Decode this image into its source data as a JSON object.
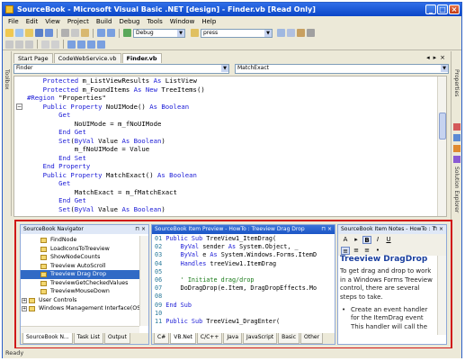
{
  "window": {
    "title": "SourceBook - Microsoft Visual Basic .NET [design] - Finder.vb [Read Only]"
  },
  "menu": [
    "File",
    "Edit",
    "View",
    "Project",
    "Build",
    "Debug",
    "Tools",
    "Window",
    "Help"
  ],
  "toolbar": {
    "config": "Debug",
    "find": "press"
  },
  "left_strip": {
    "toolbox": "Toolbox"
  },
  "right_strip": {
    "properties": "Properties",
    "solution": "Solution Explorer"
  },
  "doc_tabs": [
    "Start Page",
    "CodeWebService.vb",
    "Finder.vb"
  ],
  "editor": {
    "class_combo": "Finder",
    "member_combo": "MatchExact",
    "lines": [
      {
        "indent": "    ",
        "parts": [
          [
            "kw",
            "Protected "
          ],
          [
            "",
            "m_ListViewResults "
          ],
          [
            "kw",
            "As "
          ],
          [
            "",
            "ListView"
          ]
        ]
      },
      {
        "indent": "    ",
        "parts": [
          [
            "kw",
            "Protected "
          ],
          [
            "",
            "m_FoundItems "
          ],
          [
            "kw",
            "As New "
          ],
          [
            "",
            "TreeItems()"
          ]
        ]
      },
      {
        "indent": "",
        "parts": [
          [
            "",
            ""
          ]
        ]
      },
      {
        "indent": "",
        "parts": [
          [
            "kw",
            "#Region "
          ],
          [
            "",
            "\"Properties\""
          ]
        ]
      },
      {
        "indent": "",
        "parts": [
          [
            "",
            ""
          ]
        ]
      },
      {
        "indent": "    ",
        "parts": [
          [
            "kw",
            "Public Property "
          ],
          [
            "",
            "NoUIMode() "
          ],
          [
            "kw",
            "As Boolean"
          ]
        ]
      },
      {
        "indent": "        ",
        "parts": [
          [
            "kw",
            "Get"
          ]
        ]
      },
      {
        "indent": "            ",
        "parts": [
          [
            "",
            "NoUIMode = m_fNoUIMode"
          ]
        ]
      },
      {
        "indent": "        ",
        "parts": [
          [
            "kw",
            "End Get"
          ]
        ]
      },
      {
        "indent": "        ",
        "parts": [
          [
            "kw",
            "Set"
          ],
          [
            "",
            "("
          ],
          [
            "kw",
            "ByVal "
          ],
          [
            "",
            "Value "
          ],
          [
            "kw",
            "As Boolean"
          ],
          [
            "",
            ")"
          ]
        ]
      },
      {
        "indent": "            ",
        "parts": [
          [
            "",
            "m_fNoUIMode = Value"
          ]
        ]
      },
      {
        "indent": "        ",
        "parts": [
          [
            "kw",
            "End Set"
          ]
        ]
      },
      {
        "indent": "    ",
        "parts": [
          [
            "kw",
            "End Property"
          ]
        ]
      },
      {
        "indent": "",
        "parts": [
          [
            "",
            ""
          ]
        ]
      },
      {
        "indent": "    ",
        "parts": [
          [
            "kw",
            "Public Property "
          ],
          [
            "",
            "MatchExact() "
          ],
          [
            "kw",
            "As Boolean"
          ]
        ]
      },
      {
        "indent": "        ",
        "parts": [
          [
            "kw",
            "Get"
          ]
        ]
      },
      {
        "indent": "            ",
        "parts": [
          [
            "",
            "MatchExact = m_fMatchExact"
          ]
        ]
      },
      {
        "indent": "        ",
        "parts": [
          [
            "kw",
            "End Get"
          ]
        ]
      },
      {
        "indent": "        ",
        "parts": [
          [
            "kw",
            "Set"
          ],
          [
            "",
            "("
          ],
          [
            "kw",
            "ByVal "
          ],
          [
            "",
            "Value "
          ],
          [
            "kw",
            "As Boolean"
          ],
          [
            "",
            ")"
          ]
        ]
      }
    ]
  },
  "navigator": {
    "title": "SourceBook Navigator",
    "items": [
      {
        "label": "FindNode",
        "type": "item",
        "selected": false
      },
      {
        "label": "LoadIconsToTreeview",
        "type": "item",
        "selected": false
      },
      {
        "label": "ShowNodeCounts",
        "type": "item",
        "selected": false
      },
      {
        "label": "Treeview AutoScroll",
        "type": "item",
        "selected": false
      },
      {
        "label": "Treeview Drag Drop",
        "type": "item",
        "selected": true
      },
      {
        "label": "TreeviewGetCheckedValues",
        "type": "item",
        "selected": false
      },
      {
        "label": "TreeviewMouseDown",
        "type": "item",
        "selected": false
      },
      {
        "label": "User Controls",
        "type": "folder",
        "selected": false
      },
      {
        "label": "Windows Management Interface(OS",
        "type": "folder",
        "selected": false
      }
    ],
    "tabs": [
      "SourceBook N...",
      "Task List",
      "Output"
    ]
  },
  "preview": {
    "title": "SourceBook Item Preview - HowTo : Treeview Drag Drop",
    "lines": [
      {
        "n": "01",
        "parts": [
          [
            "kw",
            "Public Sub "
          ],
          [
            "",
            "TreeView1_ItemDrag("
          ]
        ]
      },
      {
        "n": "02",
        "parts": [
          [
            "",
            "    "
          ],
          [
            "kw",
            "ByVal "
          ],
          [
            "",
            "sender "
          ],
          [
            "kw",
            "As "
          ],
          [
            "",
            "System.Object, _"
          ]
        ]
      },
      {
        "n": "03",
        "parts": [
          [
            "",
            "    "
          ],
          [
            "kw",
            "ByVal "
          ],
          [
            "",
            "e "
          ],
          [
            "kw",
            "As "
          ],
          [
            "",
            "System.Windows.Forms.ItemD"
          ]
        ]
      },
      {
        "n": "04",
        "parts": [
          [
            "",
            "    "
          ],
          [
            "kw",
            "Handles "
          ],
          [
            "",
            "treeView1.ItemDrag"
          ]
        ]
      },
      {
        "n": "05",
        "parts": [
          [
            "",
            ""
          ]
        ]
      },
      {
        "n": "06",
        "parts": [
          [
            "",
            "    "
          ],
          [
            "cm",
            "' Initiate drag/drop"
          ]
        ]
      },
      {
        "n": "07",
        "parts": [
          [
            "",
            "    DoDragDrop(e.Item, DragDropEffects.Mo"
          ]
        ]
      },
      {
        "n": "08",
        "parts": [
          [
            "",
            ""
          ]
        ]
      },
      {
        "n": "09",
        "parts": [
          [
            "kw",
            "End Sub"
          ]
        ]
      },
      {
        "n": "10",
        "parts": [
          [
            "",
            ""
          ]
        ]
      },
      {
        "n": "11",
        "parts": [
          [
            "kw",
            "Public Sub "
          ],
          [
            "",
            "TreeView1_DragEnter("
          ]
        ]
      }
    ],
    "tabs": [
      "C#",
      "VB.Net",
      "C/C++",
      "Java",
      "JavaScript",
      "Basic",
      "Other"
    ]
  },
  "notes": {
    "title": "SourceBook Item Notes - HowTo : T",
    "heading": "Treeview DragDrop",
    "body": "To get drag and drop to work in a Windows Forms Treeview control, there are several steps to take.",
    "bullet": "Create an event handler for the ItemDrag event This handler will call the"
  },
  "status": {
    "text": "Ready"
  }
}
